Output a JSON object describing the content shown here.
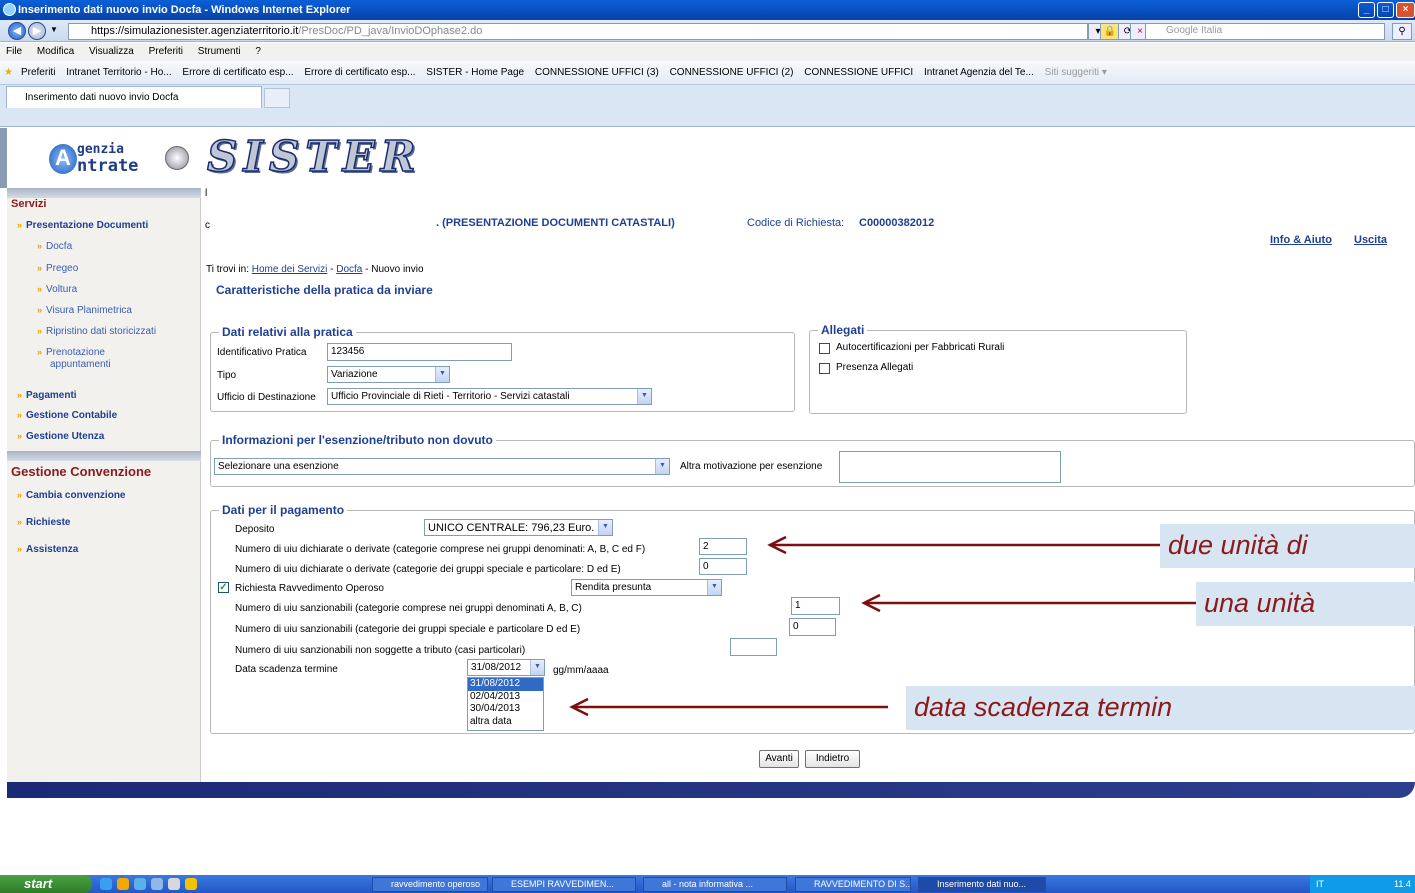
{
  "browser": {
    "title": "Inserimento dati nuovo invio Docfa - Windows Internet Explorer",
    "url_main": "https://simulazionesister.agenziaterritorio.it",
    "url_path": "/PresDoc/PD_java/InvioDOphase2.do",
    "search_placeholder": "Google Italia",
    "menu": [
      "File",
      "Modifica",
      "Visualizza",
      "Preferiti",
      "Strumenti",
      "?"
    ],
    "favorites": [
      "Preferiti",
      "Intranet Territorio - Ho...",
      "Errore di certificato esp...",
      "Errore di certificato esp...",
      "SISTER - Home Page",
      "CONNESSIONE UFFICI (3)",
      "CONNESSIONE UFFICI (2)",
      "CONNESSIONE UFFICI",
      "Intranet Agenzia del Te...",
      "Siti suggeriti ▾"
    ],
    "tab_label": "Inserimento dati nuovo invio Docfa"
  },
  "header": {
    "logo_line1": "genzia",
    "logo_line2": "ntrate",
    "logo_letter": "A",
    "title_logo": "SISTER"
  },
  "sidebar": {
    "servizi": "Servizi",
    "presentazione": "Presentazione Documenti",
    "sub": [
      "Docfa",
      "Pregeo",
      "Voltura",
      "Visura Planimetrica",
      "Ripristino dati storicizzati",
      "Prenotazione",
      "appuntamenti"
    ],
    "pagamenti": "Pagamenti",
    "contabile": "Gestione Contabile",
    "utenza": "Gestione Utenza",
    "convenzione": "Gestione Convenzione",
    "cambia": "Cambia convenzione",
    "richieste": "Richieste",
    "assistenza": "Assistenza"
  },
  "content": {
    "prefix1": "l",
    "prefix2": "c",
    "service_title": ". (PRESENTAZIONE DOCUMENTI CATASTALI)",
    "codice_label": "Codice di Richiesta:",
    "codice_value": "C00000382012",
    "info": "Info & Aiuto",
    "uscita": "Uscita",
    "breadcrumb_label": "Ti trovi in:",
    "bc_home": "Home dei Servizi",
    "bc_docfa": "Docfa",
    "bc_current": "- Nuovo invio",
    "bc_sep": "-",
    "page_title": "Caratteristiche della pratica da inviare"
  },
  "pratica": {
    "legend": "Dati relativi alla pratica",
    "id_label": "Identificativo Pratica",
    "id_value": "123456",
    "tipo_label": "Tipo",
    "tipo_value": "Variazione",
    "ufficio_label": "Ufficio di Destinazione",
    "ufficio_value": "Ufficio Provinciale di Rieti - Territorio - Servizi catastali"
  },
  "allegati": {
    "legend": "Allegati",
    "opt1": "Autocertificazioni per Fabbricati Rurali",
    "opt2": "Presenza Allegati"
  },
  "esenzione": {
    "legend": "Informazioni per l'esenzione/tributo non dovuto",
    "select_value": "Selezionare una esenzione",
    "altra_label": "Altra motivazione per esenzione"
  },
  "pagamento": {
    "legend": "Dati per il pagamento",
    "deposito_label": "Deposito",
    "deposito_value": "UNICO CENTRALE: 796,23 Euro.",
    "uiu1_label": "Numero di uiu dichiarate o derivate (categorie comprese nei gruppi denominati: A, B, C ed F)",
    "uiu1_value": "2",
    "uiu2_label": "Numero di uiu dichiarate o derivate (categorie dei gruppi speciale e particolare: D ed E)",
    "uiu2_value": "0",
    "rav_label": "Richiesta Ravvedimento Operoso",
    "rav_value": "Rendita presunta",
    "sanz1_label": "Numero di uiu sanzionabili (categorie comprese nei gruppi denominati A, B, C)",
    "sanz1_value": "1",
    "sanz2_label": "Numero di uiu sanzionabili (categorie dei gruppi speciale e particolare D ed E)",
    "sanz2_value": "0",
    "sanz3_label": "Numero di uiu sanzionabili non soggette a tributo (casi particolari)",
    "sanz3_value": "",
    "data_label": "Data scadenza termine",
    "data_value": "31/08/2012",
    "data_format": "gg/mm/aaaa",
    "options": [
      "31/08/2012",
      "02/04/2013",
      "30/04/2013",
      "altra data"
    ]
  },
  "buttons": {
    "avanti": "Avanti",
    "indietro": "Indietro"
  },
  "callouts": {
    "c1": "due unità di",
    "c2": "una unità",
    "c3": "data scadenza termin"
  },
  "taskbar": {
    "start": "start",
    "tasks": [
      "ravvedimento operoso",
      "ESEMPI RAVVEDIMEN...",
      "all - nota informativa ...",
      "RAVVEDIMENTO DI S...",
      "Inserimento dati nuo..."
    ],
    "lang": "IT",
    "clock": "11.4"
  },
  "colors": {
    "accent": "#1f3f91",
    "section_title": "#8b1a1a",
    "callout_bg": "#d7e4f2"
  }
}
